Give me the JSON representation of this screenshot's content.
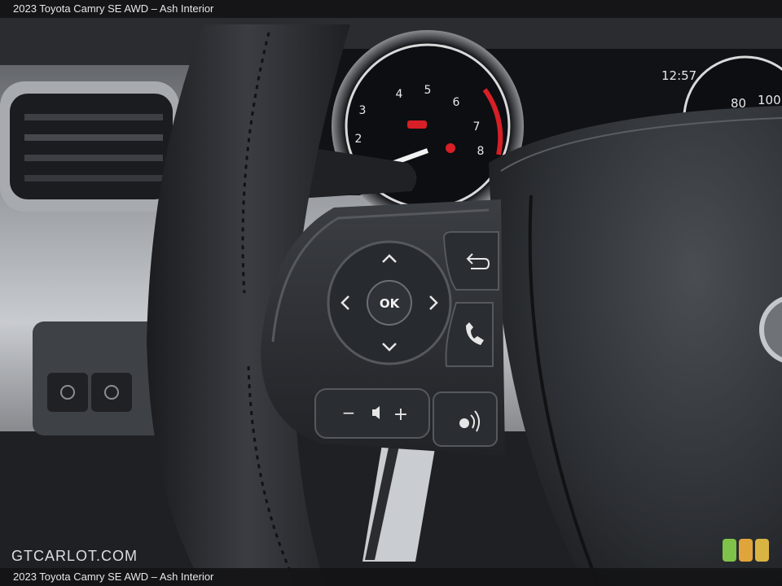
{
  "caption": {
    "top": "2023 Toyota Camry SE AWD – Ash Interior",
    "bottom": "2023 Toyota Camry SE AWD – Ash Interior"
  },
  "watermark": "GTCARLOT.COM",
  "cluster": {
    "clock": "12:57",
    "tach_labels": [
      "2",
      "3",
      "4",
      "5",
      "6",
      "7",
      "8"
    ],
    "speed_labels": [
      "80",
      "100"
    ]
  },
  "wheel_controls": {
    "ok_label": "OK",
    "volume_minus": "−",
    "volume_plus": "+"
  },
  "badge_colors": [
    "#7fc24a",
    "#e0a43a",
    "#d9b443"
  ],
  "colors": {
    "leather": "#2a2d31",
    "dash": "#c3c6ca",
    "needle": "#d61f26"
  }
}
